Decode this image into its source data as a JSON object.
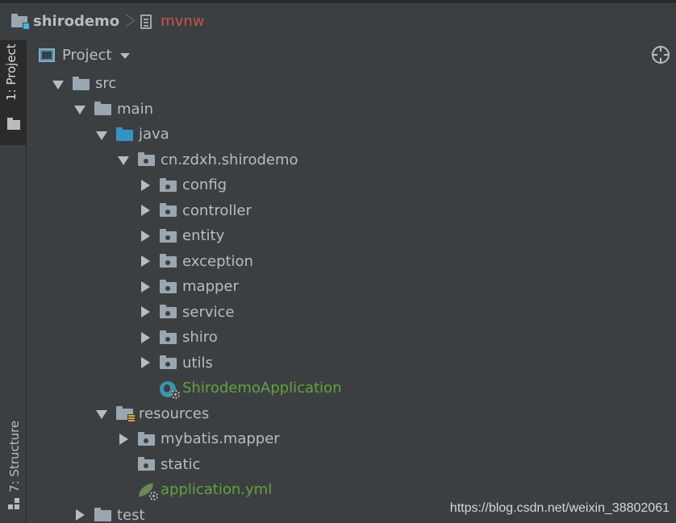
{
  "breadcrumb": {
    "project": "shirodemo",
    "file": "mvnw"
  },
  "side_strip": {
    "project_tab": "1: Project",
    "structure_tab": "7: Structure"
  },
  "panel": {
    "title": "Project"
  },
  "tree": {
    "src": "src",
    "main": "main",
    "java": "java",
    "package": "cn.zdxh.shirodemo",
    "config": "config",
    "controller": "controller",
    "entity": "entity",
    "exception": "exception",
    "mapper": "mapper",
    "service": "service",
    "shiro": "shiro",
    "utils": "utils",
    "app_class": "ShirodemoApplication",
    "resources": "resources",
    "mybatis_mapper": "mybatis.mapper",
    "static": "static",
    "app_yml": "application.yml",
    "test": "test"
  },
  "watermark": "https://blog.csdn.net/weixin_38802061",
  "colors": {
    "background": "#3c3f41",
    "text": "#bbbbbb",
    "file_error": "#c75450",
    "spring_green": "#62a23f",
    "source_folder_blue": "#3592c4"
  },
  "icons": {
    "breadcrumb_project": "project-folder-icon",
    "breadcrumb_file": "file-icon",
    "panel": "project-view-icon",
    "locate": "target-icon"
  }
}
